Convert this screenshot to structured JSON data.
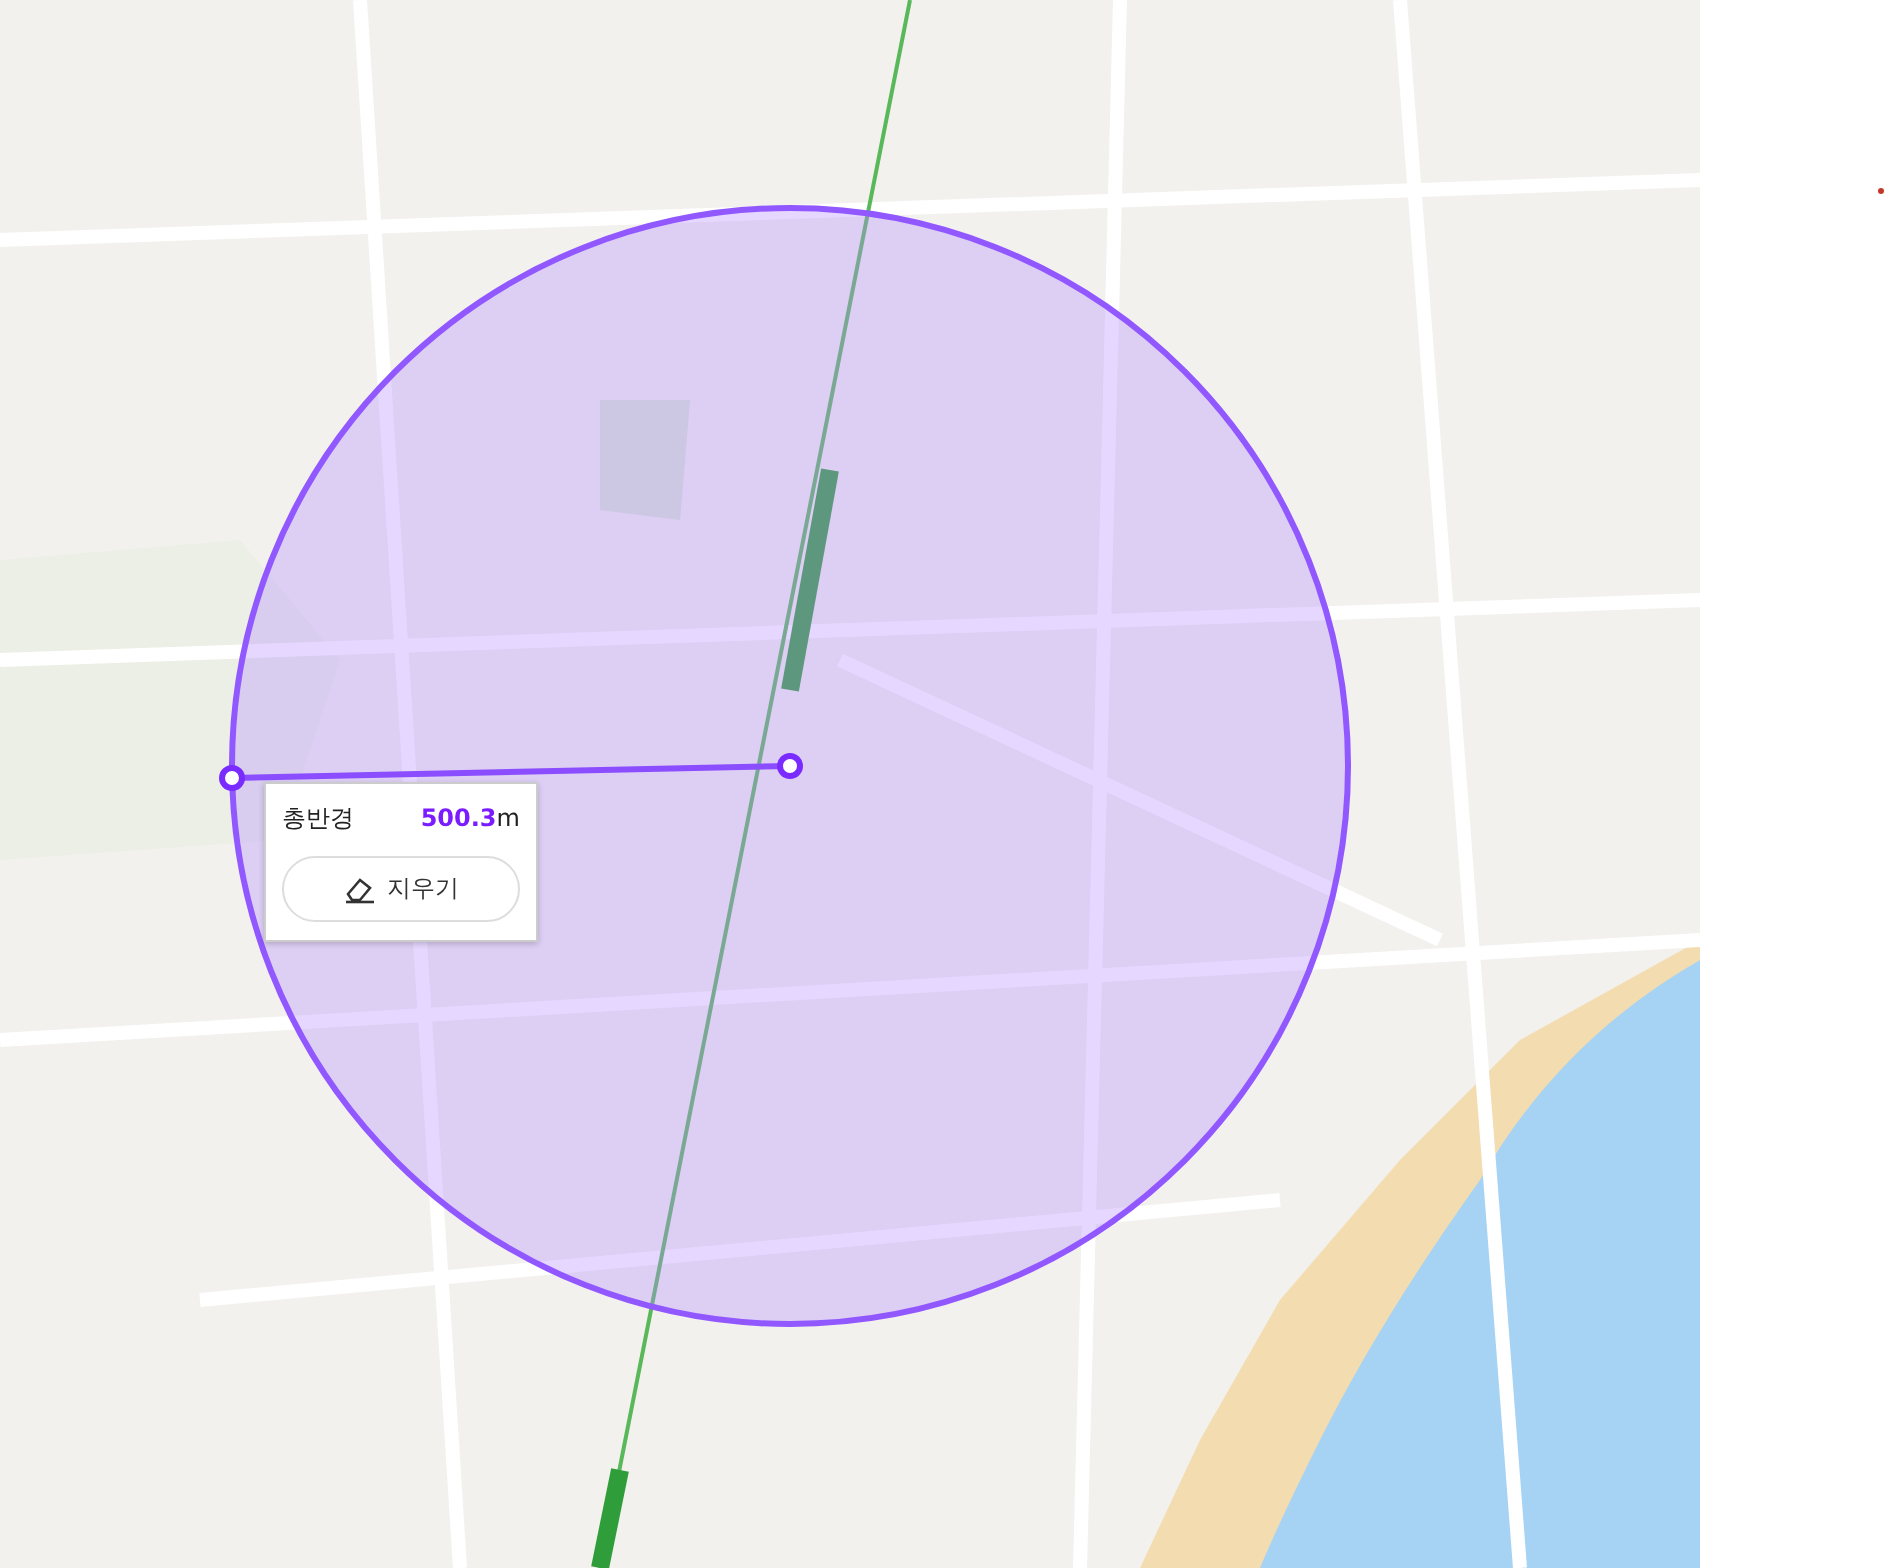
{
  "measurement": {
    "label": "총반경",
    "value": "500.3",
    "unit": "m"
  },
  "clear_button": {
    "label": "지우기"
  }
}
